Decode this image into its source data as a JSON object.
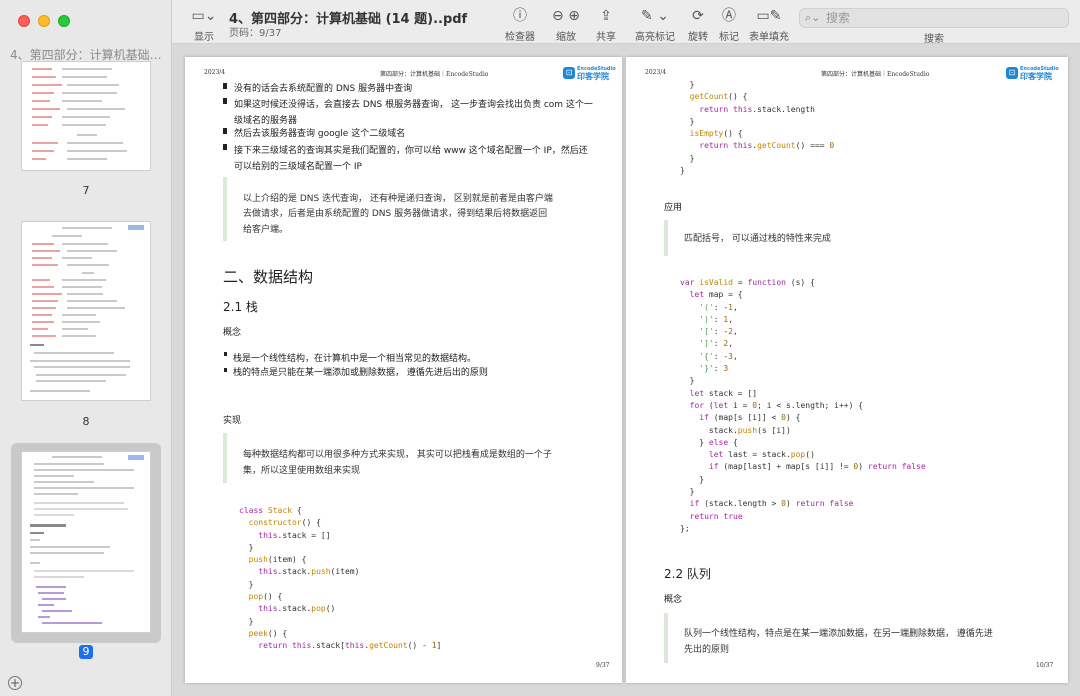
{
  "window": {
    "sidebar_title": "4、第四部分：计算机基础 ...",
    "doc_title": "4、第四部分：计算机基础 (14 题)..pdf",
    "doc_page": "页码：9/37"
  },
  "toolbar": {
    "display": "显示",
    "inspector": "检查器",
    "zoom": "缩放",
    "share": "共享",
    "highlight": "高亮标记",
    "rotate": "旋转",
    "markup": "标记",
    "form_fill": "表单填充",
    "search_placeholder": "搜索",
    "search_label": "搜索"
  },
  "thumbnails": [
    {
      "page": "7"
    },
    {
      "page": "8"
    },
    {
      "page": "9"
    }
  ],
  "page_left": {
    "header_date": "2023/4",
    "header_title": "第四部分：计算机基础｜EncodeStudio",
    "logo_en": "EncodeStudio",
    "logo_zh": "印客学院",
    "bullets_top": [
      "没有的话会去系统配置的 DNS 服务器中查询",
      "如果这时候还没得话，会直接去 DNS 根服务器查询，  这一步查询会找出负责 com 这个一",
      "级域名的服务器",
      "然后去该服务器查询 google 这个二级域名",
      "接下来三级域名的查询其实是我们配置的，你可以给 www 这个域名配置一个 IP，然后还",
      "可以给别的三级域名配置一个 IP"
    ],
    "quote1": [
      "以上介绍的是 DNS 迭代查询，  还有种是递归查询，  区别就是前者是由客户端",
      "去做请求，后者是由系统配置的 DNS 服务器做请求，得到结果后将数据返回",
      "给客户端。"
    ],
    "section_h2": "二、数据结构",
    "section_h3": "2.1 栈",
    "concept": "概念",
    "concept_bullets": [
      "栈是一个线性结构，在计算机中是一个相当常见的数据结构。",
      "栈的特点是只能在某一端添加或删除数据，  遵循先进后出的原则"
    ],
    "impl": "实现",
    "quote2": [
      "每种数据结构都可以用很多种方式来实现，  其实可以把栈看成是数组的一个子",
      "集，所以这里使用数组来实现"
    ],
    "page_number": "9/37"
  },
  "page_right": {
    "header_date": "2023/4",
    "header_title": "第四部分：计算机基础｜EncodeStudio",
    "logo_en": "EncodeStudio",
    "logo_zh": "印客学院",
    "application": "应用",
    "quote1": "匹配括号，  可以通过栈的特性来完成",
    "section_h3": "2.2 队列",
    "concept": "概念",
    "quote2": [
      "队列一个线性结构，特点是在某一端添加数据，在另一端删除数据，  遵循先进",
      "先出的原则"
    ],
    "page_number": "10/37"
  }
}
